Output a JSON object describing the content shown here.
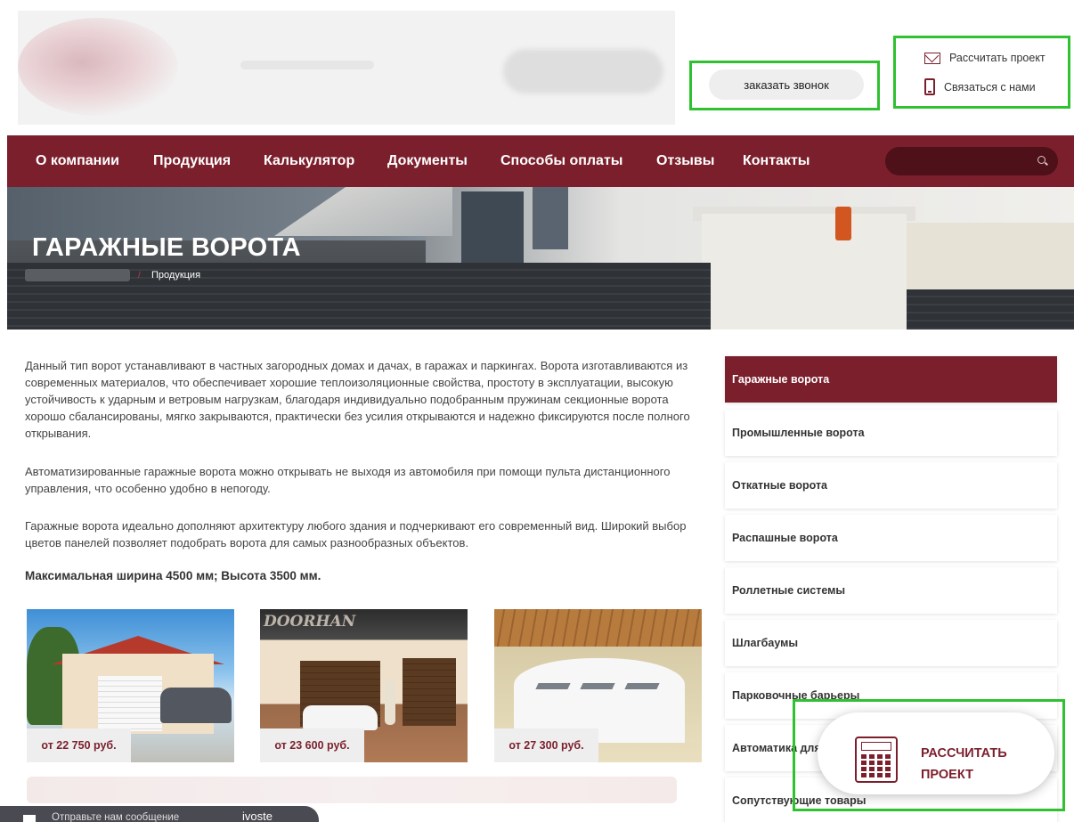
{
  "header": {
    "callback_label": "заказать звонок",
    "calc_project_label": "Рассчитать проект",
    "contact_us_label": "Связаться с нами"
  },
  "nav": {
    "items": [
      "О компании",
      "Продукция",
      "Калькулятор",
      "Документы",
      "Способы оплаты",
      "Отзывы",
      "Контакты"
    ],
    "search_placeholder": ""
  },
  "banner": {
    "title": "ГАРАЖНЫЕ ВОРОТА",
    "breadcrumb_current": "Продукция"
  },
  "content": {
    "p1": "Данный тип ворот устанавливают в частных загородных домах и дачах, в гаражах и паркингах. Ворота изготавливаются из современных материалов, что обеспечивает хорошие теплоизоляционные свойства, простоту в эксплуатации, высокую устойчивость к ударным и ветровым нагрузкам, благодаря индивидуально подобранным пружинам секционные ворота хорошо сбалансированы, мягко закрываются, практически без усилия открываются и надежно фиксируются после полного открывания.",
    "p2": "Автоматизированные гаражные ворота можно открывать не выходя из автомобиля при помощи пульта дистанционного управления, что особенно удобно в непогоду.",
    "p3": "Гаражные ворота идеально дополняют архитектуру любого здания и подчеркивают его современный вид. Широкий выбор цветов панелей позволяет подобрать ворота для самых разнообразных объектов.",
    "p4": "Максимальная ширина 4500 мм; Высота 3500 мм."
  },
  "products": [
    {
      "price": "от 22 750 руб."
    },
    {
      "price": "от 23 600 руб.",
      "watermark": "DOORHAN"
    },
    {
      "price": "от 27 300 руб."
    }
  ],
  "sidebar": {
    "items": [
      {
        "label": "Гаражные ворота",
        "active": true
      },
      {
        "label": "Промышленные ворота"
      },
      {
        "label": "Откатные ворота"
      },
      {
        "label": "Распашные ворота"
      },
      {
        "label": "Роллетные системы"
      },
      {
        "label": "Шлагбаумы"
      },
      {
        "label": "Парковочные барьеры"
      },
      {
        "label": "Автоматика для ворот"
      },
      {
        "label": "Сопутствующие товары"
      }
    ]
  },
  "floating": {
    "calc_line1": "РАССЧИТАТЬ",
    "calc_line2": "ПРОЕКТ"
  },
  "message_bar": {
    "text": "Отправьте нам сообщение",
    "text2": "ivoste"
  },
  "colors": {
    "brand": "#7b1f2c",
    "highlight_box": "#2fc12f"
  }
}
